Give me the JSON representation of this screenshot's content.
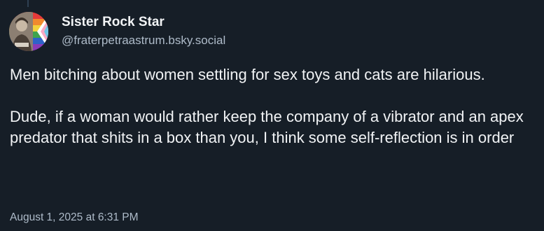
{
  "post": {
    "author": {
      "display_name": "Sister Rock Star",
      "handle": "@fraterpetraastrum.bsky.social"
    },
    "paragraphs": [
      "Men bitching about women settling for sex toys and cats are hilarious.",
      "Dude, if a woman would rather keep the company of a vibrator and an apex predator that shits in a box than you, I think some self-reflection is in order"
    ],
    "timestamp": "August 1, 2025 at 6:31 PM"
  },
  "colors": {
    "background": "#161e27",
    "text_primary": "#f1f3f5",
    "text_secondary": "#aebbc9",
    "thread_line": "#2e4052"
  },
  "avatar_icon": "person-with-pride-flag-avatar"
}
